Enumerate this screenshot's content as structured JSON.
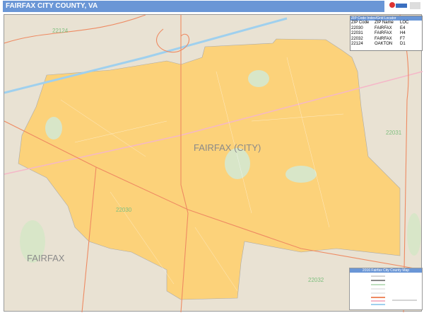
{
  "header": {
    "title": "FAIRFAX CITY COUNTY, VA"
  },
  "logo": {
    "text": "Market MAPS"
  },
  "map": {
    "city_label": "FAIRFAX (CITY)",
    "county_label": "FAIRFAX",
    "zip_labels": [
      "22124",
      "22030",
      "22031",
      "22032"
    ],
    "colors": {
      "background": "#e9e2d3",
      "city": "#fcd27a",
      "park": "#d8e6c8",
      "highway": "#9fd0ee",
      "road": "#ee8a62"
    }
  },
  "zip_table": {
    "title": "ZIP Code Index/Grid Locator",
    "headers": [
      "ZIP Code",
      "ZIP Name",
      "LOC"
    ],
    "rows": [
      [
        "22030",
        "FAIRFAX",
        "E4"
      ],
      [
        "22031",
        "FAIRFAX",
        "H4"
      ],
      [
        "22032",
        "FAIRFAX",
        "F7"
      ],
      [
        "22124",
        "OAKTON",
        "D1"
      ]
    ]
  },
  "legend": {
    "title": "2016 Fairfax City County Map"
  }
}
